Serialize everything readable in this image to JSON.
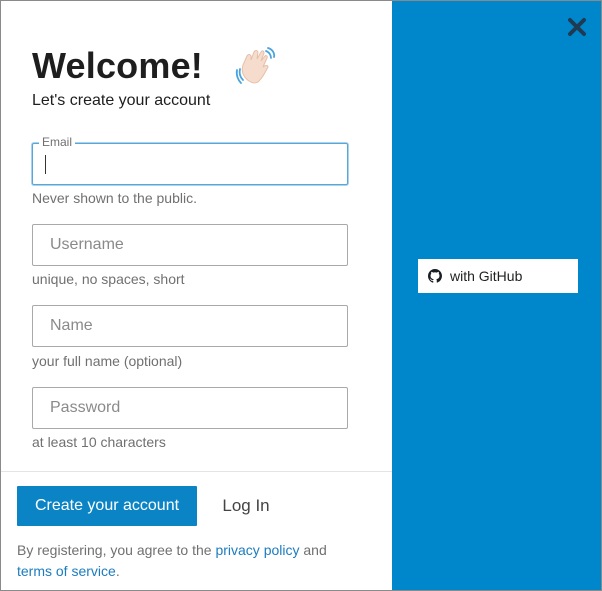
{
  "dialog": {
    "title": "Welcome!",
    "subtitle": "Let's create your account",
    "title_icon": "waving-hand-icon"
  },
  "form": {
    "email": {
      "label": "Email",
      "value": "",
      "placeholder": "",
      "hint": "Never shown to the public."
    },
    "username": {
      "placeholder": "Username",
      "value": "",
      "hint": "unique, no spaces, short"
    },
    "name": {
      "placeholder": "Name",
      "value": "",
      "hint": "your full name (optional)"
    },
    "password": {
      "placeholder": "Password",
      "value": "",
      "hint": "at least 10 characters"
    }
  },
  "actions": {
    "create_label": "Create your account",
    "login_label": "Log In"
  },
  "legal": {
    "prefix": "By registering, you agree to the ",
    "privacy_link": "privacy policy",
    "middle": " and",
    "terms_link": "terms of service",
    "suffix": "."
  },
  "side_panel": {
    "github_label": "with GitHub",
    "github_icon": "github-icon",
    "close_icon": "close-icon"
  },
  "colors": {
    "accent": "#0086cb",
    "button": "#0b84c6",
    "link": "#1c7cbf"
  }
}
